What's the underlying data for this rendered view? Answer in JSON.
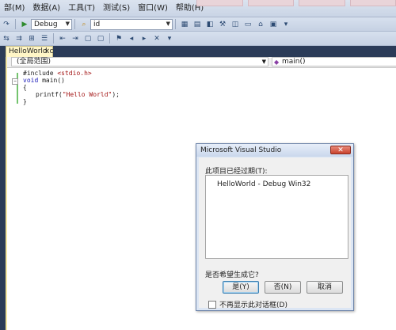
{
  "menu": [
    "部(M)",
    "数据(A)",
    "工具(T)",
    "测试(S)",
    "窗口(W)",
    "帮助(H)"
  ],
  "toolbar": {
    "config_value": "Debug",
    "find_value": "id"
  },
  "editor": {
    "tab_title": "HelloWorld.c",
    "scope_left": "(全局范围)",
    "scope_right": "main()",
    "code": {
      "line1_directive": "#include ",
      "line1_header": "<stdio.h>",
      "line2_kw": "void",
      "line2_rest": " main()",
      "line3": "{",
      "line4_call": "printf(",
      "line4_str": "\"Hello World\"",
      "line4_end": ");",
      "line5": "}"
    }
  },
  "dialog": {
    "title": "Microsoft Visual Studio",
    "message": "此项目已经过期(T):",
    "project_item": "HelloWorld - Debug Win32",
    "question": "是否希望生成它?",
    "yes_label": "是(Y)",
    "no_label": "否(N)",
    "cancel_label": "取消",
    "checkbox_label": "不再显示此对话框(D)"
  },
  "colors": {
    "ide_background": "#2b3b58",
    "string_color": "#a31515",
    "keyword_color": "#1a1ab8",
    "change_bar": "#74c46e"
  }
}
